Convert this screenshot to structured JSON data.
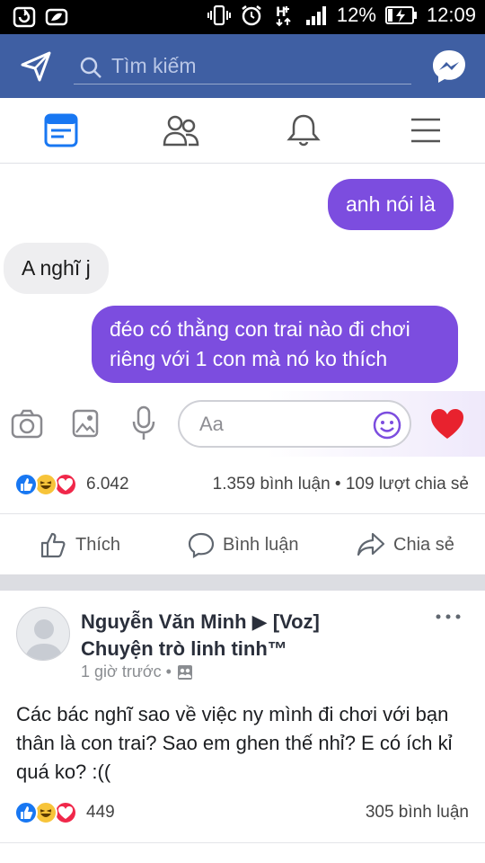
{
  "status_bar": {
    "battery": "12%",
    "time": "12:09"
  },
  "top_bar": {
    "search_placeholder": "Tìm kiếm"
  },
  "tabs": [
    "news-feed",
    "friends",
    "notifications",
    "menu"
  ],
  "chat": {
    "messages": [
      {
        "direction": "out",
        "text": "anh nói là"
      },
      {
        "direction": "in",
        "text": "A nghĩ j"
      },
      {
        "direction": "out",
        "line1": "đéo có thằng con trai nào đi chơi",
        "line2": "riêng với 1 con mà nó ko thích"
      }
    ],
    "composer_placeholder": "Aa"
  },
  "post1": {
    "reaction_count": "6.042",
    "stats": "1.359 bình luận • 109 lượt chia sẻ",
    "actions": {
      "like": "Thích",
      "comment": "Bình luận",
      "share": "Chia sẻ"
    }
  },
  "post2": {
    "author_line1": "Nguyễn Văn Minh ▶ [Voz]",
    "author_line2": "Chuyện trò linh tinh™",
    "time": "1 giờ trước •",
    "body": "Các bác nghĩ sao về việc ny mình đi chơi với bạn thân là con trai? Sao em ghen thế nhỉ? E có ích kỉ quá ko? :((",
    "reaction_count": "449",
    "comments": "305 bình luận"
  },
  "colors": {
    "brand_blue": "#3f5fa3",
    "bubble_purple": "#7c4ddf",
    "like_blue": "#1877f2",
    "love_red": "#f0284a",
    "haha_yellow": "#f7c43a"
  }
}
